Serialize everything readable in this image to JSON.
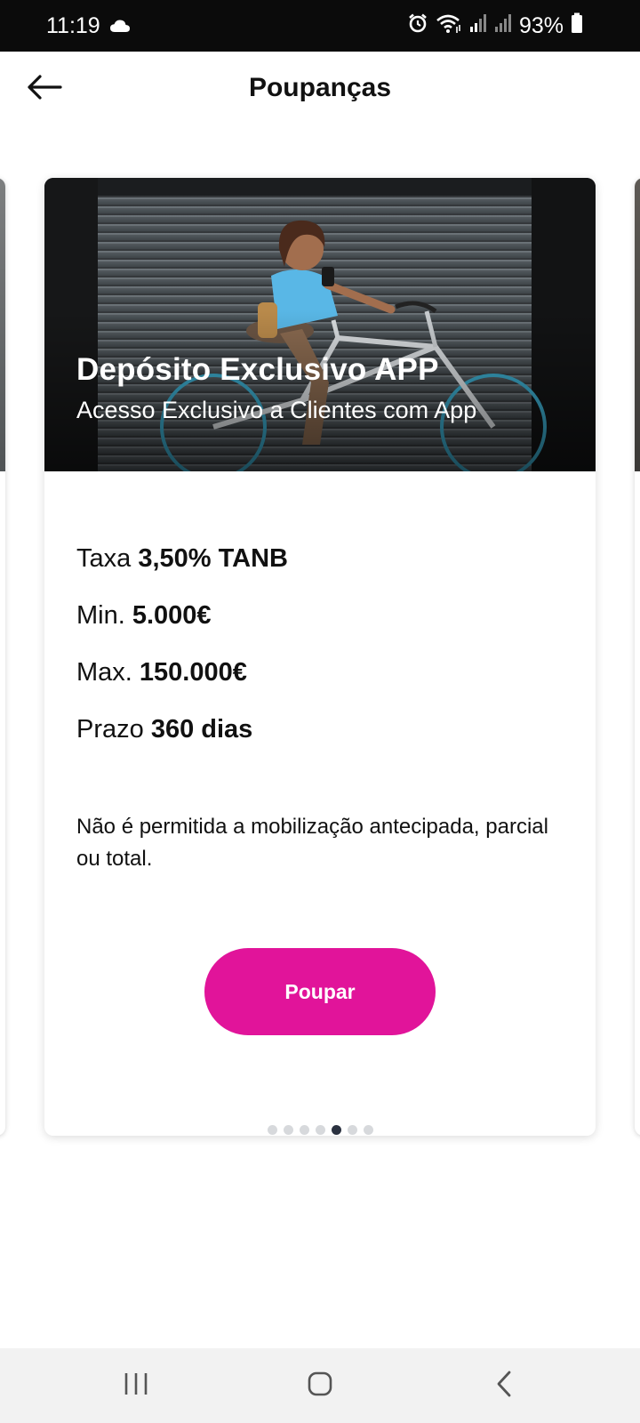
{
  "status_bar": {
    "time": "11:19",
    "battery": "93%",
    "icons": [
      "cloud-icon",
      "alarm-icon",
      "wifi-icon",
      "signal-icon",
      "signal-icon",
      "battery-icon"
    ]
  },
  "header": {
    "title": "Poupanças",
    "back_icon": "arrow-left-icon"
  },
  "card": {
    "title": "Depósito Exclusivo APP",
    "subtitle": "Acesso Exclusivo a Clientes com App",
    "details": [
      {
        "label": "Taxa",
        "value": "3,50% TANB"
      },
      {
        "label": "Min.",
        "value": "5.000€"
      },
      {
        "label": "Max.",
        "value": "150.000€"
      },
      {
        "label": "Prazo",
        "value": "360 dias"
      }
    ],
    "notice": "Não é permitida a mobilização antecipada, parcial ou total.",
    "cta_label": "Poupar"
  },
  "pager": {
    "count": 7,
    "active_index": 4
  },
  "colors": {
    "accent": "#e1149a",
    "active_dot": "#2b3240",
    "inactive_dot": "#d7d9dc"
  },
  "nav_bar": {
    "icons": [
      "recent-apps-icon",
      "home-icon",
      "back-icon"
    ]
  }
}
